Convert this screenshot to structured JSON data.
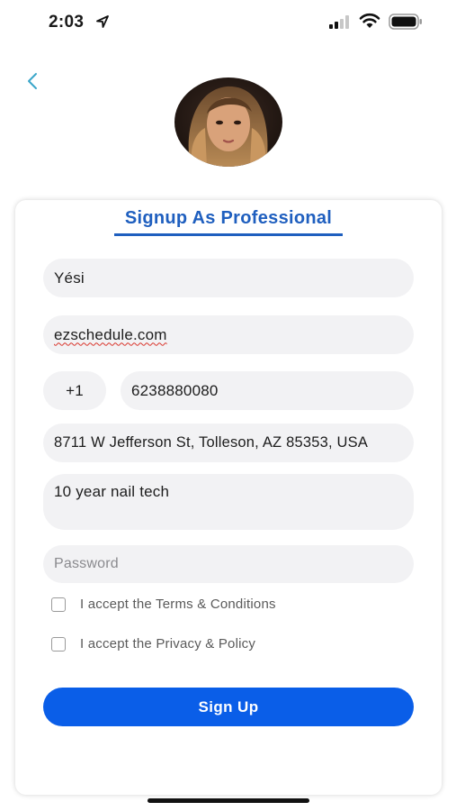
{
  "status_bar": {
    "time": "2:03",
    "icons": [
      "location-icon",
      "signal-icon",
      "wifi-icon",
      "battery-icon"
    ]
  },
  "header": {
    "back_icon": "chevron-left-icon",
    "avatar": "profile-photo"
  },
  "form": {
    "title": "Signup As Professional",
    "name_value": "Yési",
    "email_value": "ezschedule.com",
    "country_code": "+1",
    "phone_value": "6238880080",
    "address_value": "8711 W Jefferson St, Tolleson, AZ 85353, USA",
    "bio_value": "10 year nail tech",
    "password_placeholder": "Password",
    "terms_label": "I accept the Terms & Conditions",
    "privacy_label": "I accept the Privacy & Policy",
    "submit_label": "Sign Up"
  },
  "colors": {
    "accent": "#1f5fbf",
    "button": "#0a5ee8",
    "field_bg": "#f2f2f4",
    "back_icon": "#3aa6c9"
  }
}
